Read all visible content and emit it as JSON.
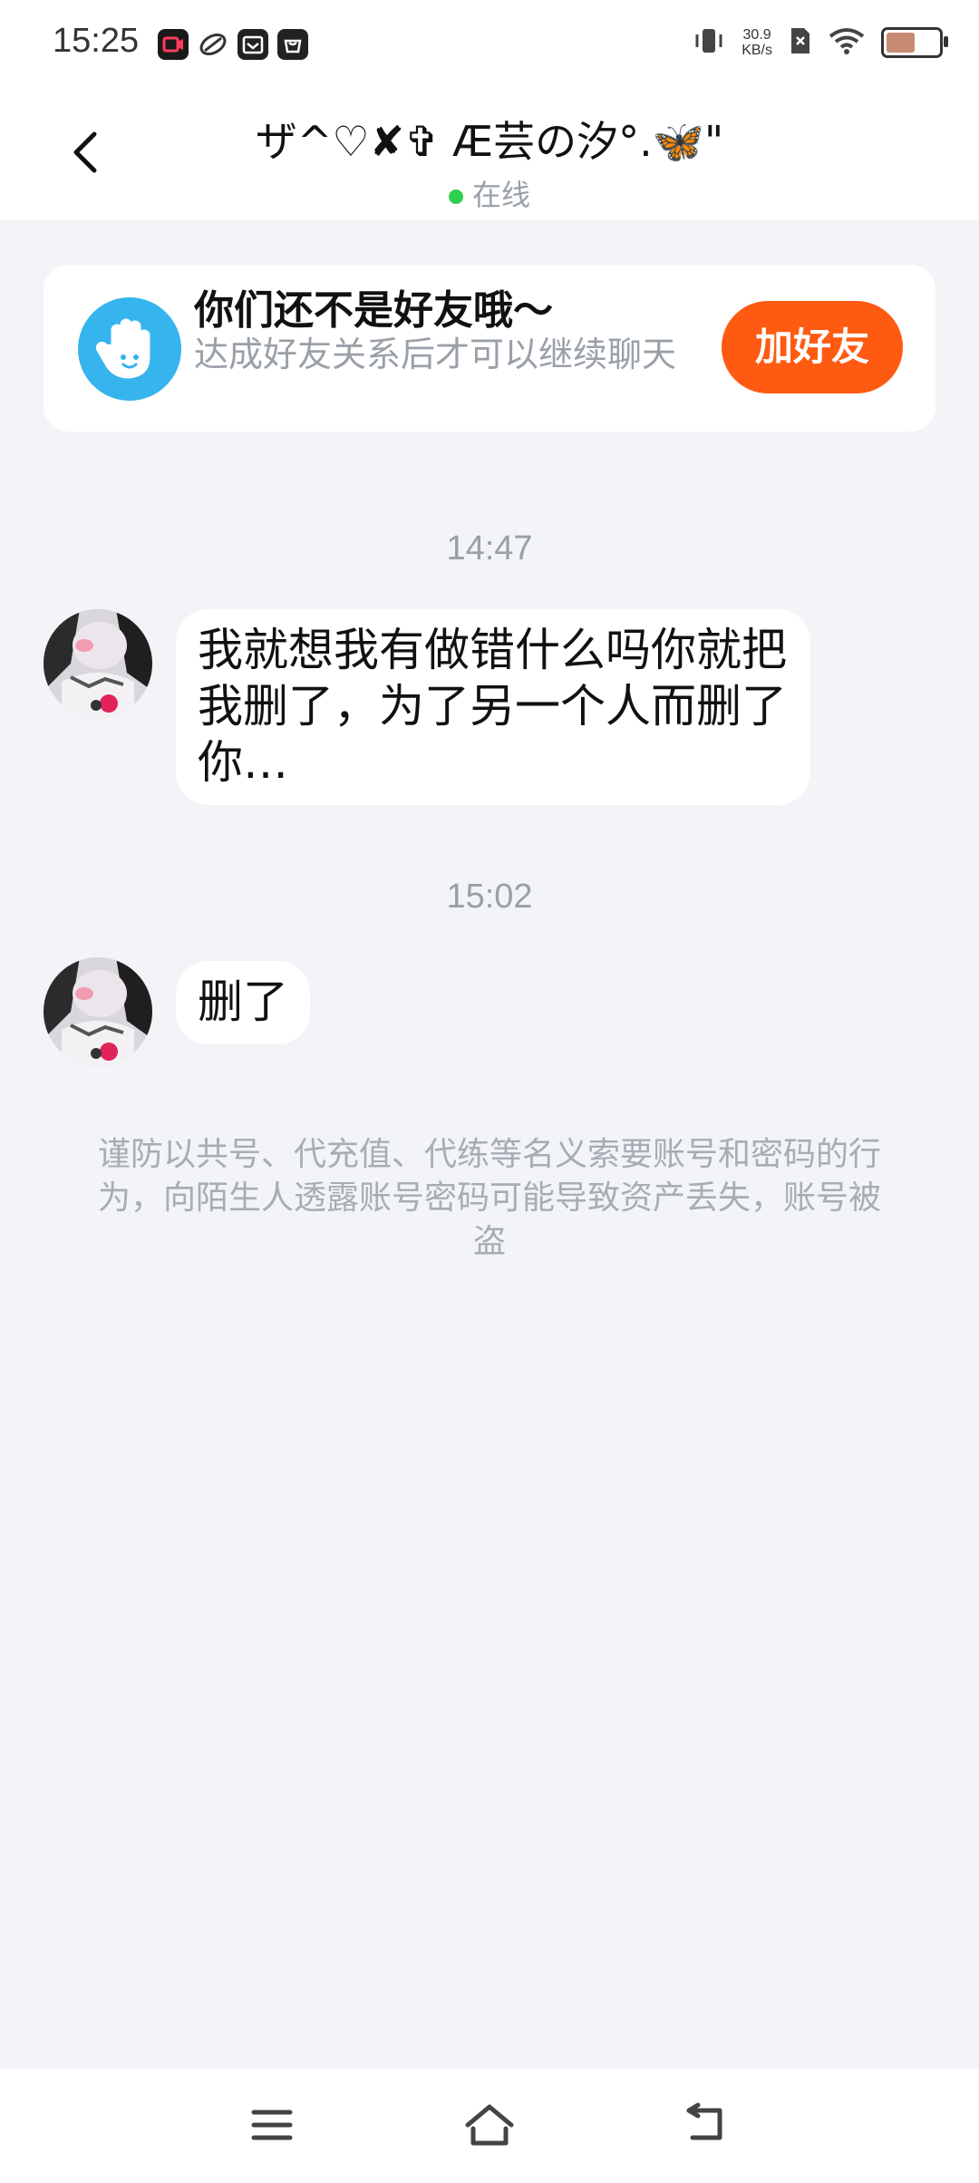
{
  "status_bar": {
    "time": "15:25",
    "network_speed_value": "30.9",
    "network_speed_unit": "KB/s",
    "battery_level": 0.55,
    "icons": [
      "video-recorder-icon",
      "app-icon",
      "mail-icon",
      "shopping-bag-icon",
      "vibrate-icon",
      "sim-disabled-icon",
      "wifi-icon",
      "battery-icon"
    ]
  },
  "header": {
    "title": "ザ^♡✘✞ Æ芸の汐°.🦋\"",
    "status": "在线"
  },
  "friend_card": {
    "title": "你们还不是好友哦～",
    "subtitle": "达成好友关系后才可以继续聊天",
    "add_button": "加好友"
  },
  "messages": [
    {
      "timestamp": "14:47",
      "text": "我就想我有做错什么吗你就把我删了，为了另一个人而删了你…"
    },
    {
      "timestamp": "15:02",
      "text": "删了"
    }
  ],
  "notice": "谨防以共号、代充值、代练等名义索要账号和密码的行为，向陌生人透露账号密码可能导致资产丢失，账号被盗",
  "colors": {
    "add_button": "#ff5a12",
    "online_dot": "#2fcf4f",
    "card_icon": "#36b4ee",
    "background": "#f2f4f7"
  }
}
